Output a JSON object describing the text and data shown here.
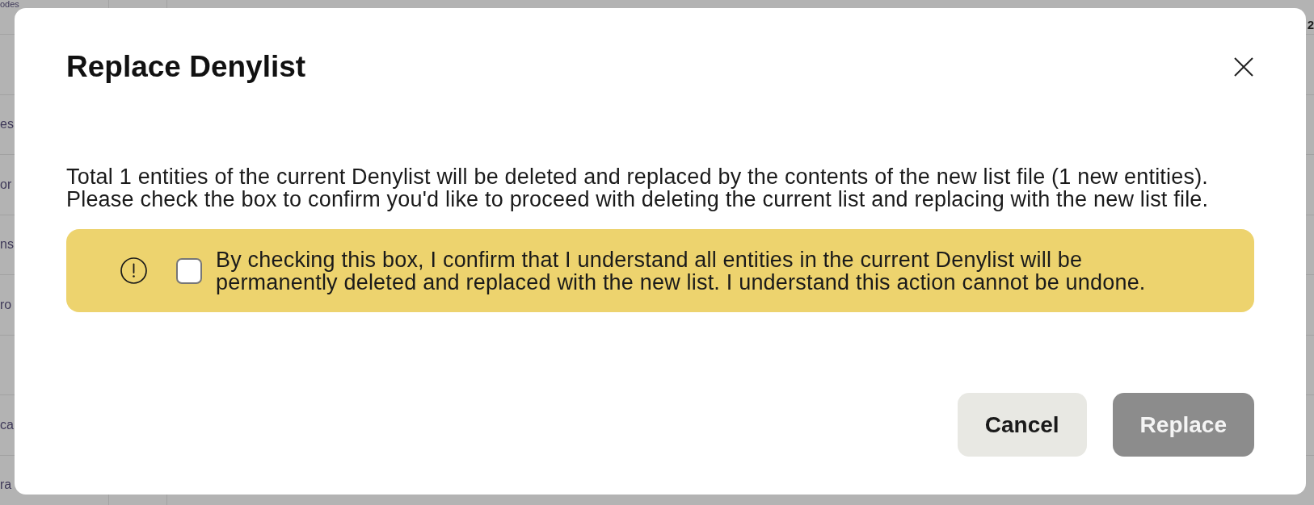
{
  "background": {
    "rows": [
      {
        "column_1": "odes"
      },
      {},
      {
        "column_1": "es"
      },
      {
        "column_1": "or"
      },
      {
        "column_1": "ns"
      },
      {
        "column_1": "ro"
      },
      {},
      {
        "column_1": "ca"
      },
      {
        "column_1": "ra"
      }
    ],
    "right_column_text": "2"
  },
  "dialog": {
    "title": "Replace Denylist",
    "message": "Total 1 entities of the current Denylist will be deleted and replaced by the contents of the new list file (1 new entities). Please check the box to confirm you'd like to proceed with deleting the current list and replacing with the new list file.",
    "confirmation": {
      "checked": false,
      "label": "By checking this box, I confirm that I understand all entities in the current Denylist will be permanently deleted and replaced with the new list. I understand this action cannot be undone."
    },
    "buttons": [
      {
        "label": "Cancel",
        "kind": "secondary",
        "disabled": false
      },
      {
        "label": "Replace",
        "kind": "primary",
        "disabled": true
      }
    ]
  }
}
